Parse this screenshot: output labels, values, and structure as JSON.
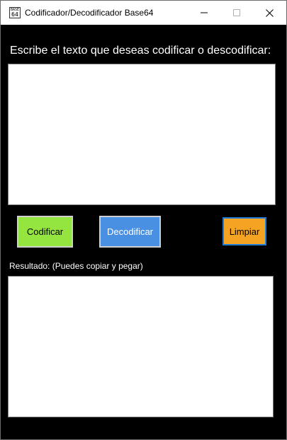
{
  "window": {
    "title": "Codificador/Decodificador Base64",
    "icon_name": "base64-app-icon",
    "icon_top_text": "BASE",
    "icon_bottom_text": "64"
  },
  "form": {
    "prompt": "Escribe el texto que deseas codificar o descodificar:",
    "input_value": "",
    "result_label": "Resultado: (Puedes copiar y pegar)",
    "output_value": ""
  },
  "buttons": {
    "encode_label": "Codificar",
    "decode_label": "Decodificar",
    "clear_label": "Limpiar"
  },
  "colors": {
    "background": "#000000",
    "encode_button": "#95e541",
    "decode_button": "#4a90e2",
    "clear_button": "#f5a323",
    "focus_border": "#1e7bd6"
  }
}
